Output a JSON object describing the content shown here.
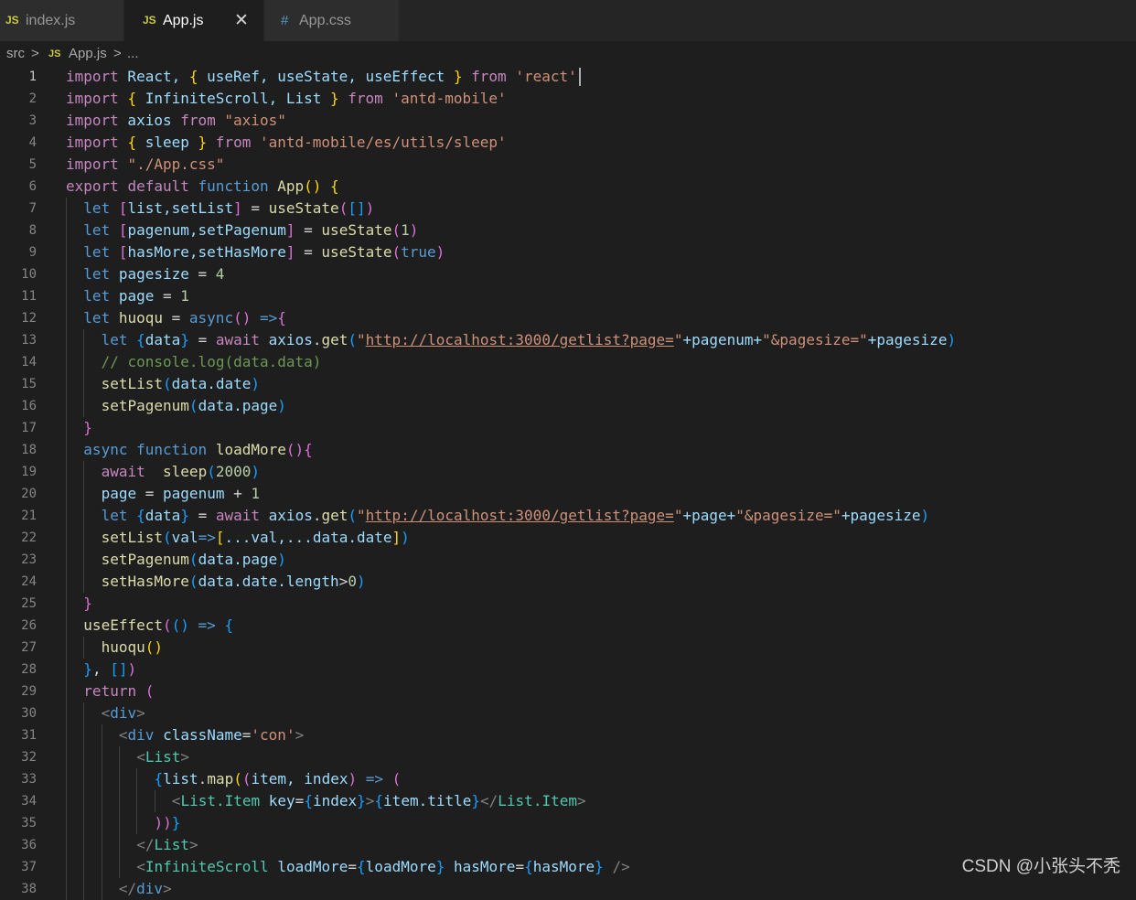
{
  "tabs": [
    {
      "icon": "JS",
      "label": "index.js"
    },
    {
      "icon": "JS",
      "label": "App.js",
      "close": "✕"
    },
    {
      "icon": "#",
      "label": "App.css"
    }
  ],
  "breadcrumb": {
    "folder": "src",
    "sep1": ">",
    "file_icon": "JS",
    "file": "App.js",
    "sep2": ">",
    "more": "..."
  },
  "editor": {
    "active_line": 1,
    "cursor_line": 1,
    "lines": [
      {
        "n": "1",
        "indent": 0,
        "tokens": [
          [
            "import",
            "ctl"
          ],
          [
            " React, ",
            "var"
          ],
          [
            "{",
            "b1"
          ],
          [
            " useRef, useState, useEffect ",
            "var"
          ],
          [
            "}",
            "b1"
          ],
          [
            " ",
            "plain"
          ],
          [
            "from",
            "ctl"
          ],
          [
            " ",
            "plain"
          ],
          [
            "'react'",
            "str"
          ]
        ]
      },
      {
        "n": "2",
        "indent": 0,
        "tokens": [
          [
            "import",
            "ctl"
          ],
          [
            " ",
            "plain"
          ],
          [
            "{",
            "b1"
          ],
          [
            " InfiniteScroll, List ",
            "var"
          ],
          [
            "}",
            "b1"
          ],
          [
            " ",
            "plain"
          ],
          [
            "from",
            "ctl"
          ],
          [
            " ",
            "plain"
          ],
          [
            "'antd-mobile'",
            "str"
          ]
        ]
      },
      {
        "n": "3",
        "indent": 0,
        "tokens": [
          [
            "import",
            "ctl"
          ],
          [
            " axios ",
            "var"
          ],
          [
            "from",
            "ctl"
          ],
          [
            " ",
            "plain"
          ],
          [
            "\"axios\"",
            "str"
          ]
        ]
      },
      {
        "n": "4",
        "indent": 0,
        "tokens": [
          [
            "import",
            "ctl"
          ],
          [
            " ",
            "plain"
          ],
          [
            "{",
            "b1"
          ],
          [
            " sleep ",
            "var"
          ],
          [
            "}",
            "b1"
          ],
          [
            " ",
            "plain"
          ],
          [
            "from",
            "ctl"
          ],
          [
            " ",
            "plain"
          ],
          [
            "'antd-mobile/es/utils/sleep'",
            "str"
          ]
        ]
      },
      {
        "n": "5",
        "indent": 0,
        "tokens": [
          [
            "import",
            "ctl"
          ],
          [
            " ",
            "plain"
          ],
          [
            "\"./App.css\"",
            "str"
          ]
        ]
      },
      {
        "n": "6",
        "indent": 0,
        "tokens": [
          [
            "export",
            "ctl"
          ],
          [
            " ",
            "plain"
          ],
          [
            "default",
            "ctl"
          ],
          [
            " ",
            "plain"
          ],
          [
            "function",
            "kw"
          ],
          [
            " ",
            "plain"
          ],
          [
            "App",
            "fn"
          ],
          [
            "()",
            "b1"
          ],
          [
            " ",
            "plain"
          ],
          [
            "{",
            "b1"
          ]
        ]
      },
      {
        "n": "7",
        "indent": 1,
        "tokens": [
          [
            "let",
            "kw"
          ],
          [
            " ",
            "plain"
          ],
          [
            "[",
            "b2"
          ],
          [
            "list,setList",
            "var"
          ],
          [
            "]",
            "b2"
          ],
          [
            " = ",
            "plain"
          ],
          [
            "useState",
            "fn"
          ],
          [
            "(",
            "b2"
          ],
          [
            "[]",
            "b3"
          ],
          [
            ")",
            "b2"
          ]
        ]
      },
      {
        "n": "8",
        "indent": 1,
        "tokens": [
          [
            "let",
            "kw"
          ],
          [
            " ",
            "plain"
          ],
          [
            "[",
            "b2"
          ],
          [
            "pagenum,setPagenum",
            "var"
          ],
          [
            "]",
            "b2"
          ],
          [
            " = ",
            "plain"
          ],
          [
            "useState",
            "fn"
          ],
          [
            "(",
            "b2"
          ],
          [
            "1",
            "num"
          ],
          [
            ")",
            "b2"
          ]
        ]
      },
      {
        "n": "9",
        "indent": 1,
        "tokens": [
          [
            "let",
            "kw"
          ],
          [
            " ",
            "plain"
          ],
          [
            "[",
            "b2"
          ],
          [
            "hasMore,setHasMore",
            "var"
          ],
          [
            "]",
            "b2"
          ],
          [
            " = ",
            "plain"
          ],
          [
            "useState",
            "fn"
          ],
          [
            "(",
            "b2"
          ],
          [
            "true",
            "kw"
          ],
          [
            ")",
            "b2"
          ]
        ]
      },
      {
        "n": "10",
        "indent": 1,
        "tokens": [
          [
            "let",
            "kw"
          ],
          [
            " pagesize ",
            "var"
          ],
          [
            "= ",
            "plain"
          ],
          [
            "4",
            "num"
          ]
        ]
      },
      {
        "n": "11",
        "indent": 1,
        "tokens": [
          [
            "let",
            "kw"
          ],
          [
            " page ",
            "var"
          ],
          [
            "= ",
            "plain"
          ],
          [
            "1",
            "num"
          ]
        ]
      },
      {
        "n": "12",
        "indent": 1,
        "tokens": [
          [
            "let",
            "kw"
          ],
          [
            " huoqu ",
            "fn"
          ],
          [
            "= ",
            "plain"
          ],
          [
            "async",
            "kw"
          ],
          [
            "()",
            "b2"
          ],
          [
            " ",
            "plain"
          ],
          [
            "=>",
            "kw"
          ],
          [
            "{",
            "b2"
          ]
        ]
      },
      {
        "n": "13",
        "indent": 2,
        "tokens": [
          [
            "let",
            "kw"
          ],
          [
            " ",
            "plain"
          ],
          [
            "{",
            "b3"
          ],
          [
            "data",
            "var"
          ],
          [
            "}",
            "b3"
          ],
          [
            " = ",
            "plain"
          ],
          [
            "await",
            "ctl"
          ],
          [
            " axios",
            "var"
          ],
          [
            ".",
            "plain"
          ],
          [
            "get",
            "fn"
          ],
          [
            "(",
            "b3"
          ],
          [
            "\"",
            "str"
          ],
          [
            "http://localhost:3000/getlist?page=",
            "str url"
          ],
          [
            "\"",
            "str"
          ],
          [
            "+pagenum+",
            "var"
          ],
          [
            "\"&pagesize=\"",
            "str"
          ],
          [
            "+pagesize",
            "var"
          ],
          [
            ")",
            "b3"
          ]
        ]
      },
      {
        "n": "14",
        "indent": 2,
        "tokens": [
          [
            "// console.log(data.data)",
            "cmt"
          ]
        ]
      },
      {
        "n": "15",
        "indent": 2,
        "tokens": [
          [
            "setList",
            "fn"
          ],
          [
            "(",
            "b3"
          ],
          [
            "data.date",
            "var"
          ],
          [
            ")",
            "b3"
          ]
        ]
      },
      {
        "n": "16",
        "indent": 2,
        "tokens": [
          [
            "setPagenum",
            "fn"
          ],
          [
            "(",
            "b3"
          ],
          [
            "data.page",
            "var"
          ],
          [
            ")",
            "b3"
          ]
        ]
      },
      {
        "n": "17",
        "indent": 1,
        "tokens": [
          [
            "}",
            "b2"
          ]
        ]
      },
      {
        "n": "18",
        "indent": 1,
        "tokens": [
          [
            "async",
            "kw"
          ],
          [
            " ",
            "plain"
          ],
          [
            "function",
            "kw"
          ],
          [
            " ",
            "plain"
          ],
          [
            "loadMore",
            "fn"
          ],
          [
            "()",
            "b2"
          ],
          [
            "{",
            "b2"
          ]
        ]
      },
      {
        "n": "19",
        "indent": 2,
        "tokens": [
          [
            "await",
            "ctl"
          ],
          [
            "  ",
            "plain"
          ],
          [
            "sleep",
            "fn"
          ],
          [
            "(",
            "b3"
          ],
          [
            "2000",
            "num"
          ],
          [
            ")",
            "b3"
          ]
        ]
      },
      {
        "n": "20",
        "indent": 2,
        "tokens": [
          [
            "page ",
            "var"
          ],
          [
            "= ",
            "plain"
          ],
          [
            "pagenum ",
            "var"
          ],
          [
            "+ ",
            "plain"
          ],
          [
            "1",
            "num"
          ]
        ]
      },
      {
        "n": "21",
        "indent": 2,
        "tokens": [
          [
            "let",
            "kw"
          ],
          [
            " ",
            "plain"
          ],
          [
            "{",
            "b3"
          ],
          [
            "data",
            "var"
          ],
          [
            "}",
            "b3"
          ],
          [
            " = ",
            "plain"
          ],
          [
            "await",
            "ctl"
          ],
          [
            " axios",
            "var"
          ],
          [
            ".",
            "plain"
          ],
          [
            "get",
            "fn"
          ],
          [
            "(",
            "b3"
          ],
          [
            "\"",
            "str"
          ],
          [
            "http://localhost:3000/getlist?page=",
            "str url"
          ],
          [
            "\"",
            "str"
          ],
          [
            "+page+",
            "var"
          ],
          [
            "\"&pagesize=\"",
            "str"
          ],
          [
            "+pagesize",
            "var"
          ],
          [
            ")",
            "b3"
          ]
        ]
      },
      {
        "n": "22",
        "indent": 2,
        "tokens": [
          [
            "setList",
            "fn"
          ],
          [
            "(",
            "b3"
          ],
          [
            "val",
            "var"
          ],
          [
            "=>",
            "kw"
          ],
          [
            "[",
            "b1"
          ],
          [
            "...val,...data.date",
            "var"
          ],
          [
            "]",
            "b1"
          ],
          [
            ")",
            "b3"
          ]
        ]
      },
      {
        "n": "23",
        "indent": 2,
        "tokens": [
          [
            "setPagenum",
            "fn"
          ],
          [
            "(",
            "b3"
          ],
          [
            "data.page",
            "var"
          ],
          [
            ")",
            "b3"
          ]
        ]
      },
      {
        "n": "24",
        "indent": 2,
        "tokens": [
          [
            "setHasMore",
            "fn"
          ],
          [
            "(",
            "b3"
          ],
          [
            "data.date.length",
            "var"
          ],
          [
            ">",
            "plain"
          ],
          [
            "0",
            "num"
          ],
          [
            ")",
            "b3"
          ]
        ]
      },
      {
        "n": "25",
        "indent": 1,
        "tokens": [
          [
            "}",
            "b2"
          ]
        ]
      },
      {
        "n": "26",
        "indent": 1,
        "tokens": [
          [
            "useEffect",
            "fn"
          ],
          [
            "(",
            "b2"
          ],
          [
            "()",
            "b3"
          ],
          [
            " ",
            "plain"
          ],
          [
            "=>",
            "kw"
          ],
          [
            " ",
            "plain"
          ],
          [
            "{",
            "b3"
          ]
        ]
      },
      {
        "n": "27",
        "indent": 2,
        "tokens": [
          [
            "huoqu",
            "fn"
          ],
          [
            "()",
            "b1"
          ]
        ]
      },
      {
        "n": "28",
        "indent": 1,
        "tokens": [
          [
            "}",
            "b3"
          ],
          [
            ", ",
            "plain"
          ],
          [
            "[]",
            "b3"
          ],
          [
            ")",
            "b2"
          ]
        ]
      },
      {
        "n": "29",
        "indent": 1,
        "tokens": [
          [
            "return",
            "ctl"
          ],
          [
            " ",
            "plain"
          ],
          [
            "(",
            "b2"
          ]
        ]
      },
      {
        "n": "30",
        "indent": 2,
        "tokens": [
          [
            "<",
            "punc"
          ],
          [
            "div",
            "tag"
          ],
          [
            ">",
            "punc"
          ]
        ]
      },
      {
        "n": "31",
        "indent": 3,
        "tokens": [
          [
            "<",
            "punc"
          ],
          [
            "div",
            "tag"
          ],
          [
            " className",
            "var"
          ],
          [
            "=",
            "plain"
          ],
          [
            "'con'",
            "str"
          ],
          [
            ">",
            "punc"
          ]
        ]
      },
      {
        "n": "32",
        "indent": 4,
        "tokens": [
          [
            "<",
            "punc"
          ],
          [
            "List",
            "cls"
          ],
          [
            ">",
            "punc"
          ]
        ]
      },
      {
        "n": "33",
        "indent": 5,
        "tokens": [
          [
            "{",
            "b3"
          ],
          [
            "list",
            "var"
          ],
          [
            ".",
            "plain"
          ],
          [
            "map",
            "fn"
          ],
          [
            "(",
            "b1"
          ],
          [
            "(",
            "b2"
          ],
          [
            "item, index",
            "var"
          ],
          [
            ")",
            "b2"
          ],
          [
            " ",
            "plain"
          ],
          [
            "=>",
            "kw"
          ],
          [
            " ",
            "plain"
          ],
          [
            "(",
            "b2"
          ]
        ]
      },
      {
        "n": "34",
        "indent": 6,
        "tokens": [
          [
            "<",
            "punc"
          ],
          [
            "List.Item",
            "cls"
          ],
          [
            " key",
            "var"
          ],
          [
            "=",
            "plain"
          ],
          [
            "{",
            "b3"
          ],
          [
            "index",
            "var"
          ],
          [
            "}",
            "b3"
          ],
          [
            ">",
            "punc"
          ],
          [
            "{",
            "b3"
          ],
          [
            "item.title",
            "var"
          ],
          [
            "}",
            "b3"
          ],
          [
            "</",
            "punc"
          ],
          [
            "List.Item",
            "cls"
          ],
          [
            ">",
            "punc"
          ]
        ]
      },
      {
        "n": "35",
        "indent": 5,
        "tokens": [
          [
            "))",
            "b2"
          ],
          [
            "}",
            "b3"
          ]
        ]
      },
      {
        "n": "36",
        "indent": 4,
        "tokens": [
          [
            "</",
            "punc"
          ],
          [
            "List",
            "cls"
          ],
          [
            ">",
            "punc"
          ]
        ]
      },
      {
        "n": "37",
        "indent": 4,
        "tokens": [
          [
            "<",
            "punc"
          ],
          [
            "InfiniteScroll",
            "cls"
          ],
          [
            " loadMore",
            "var"
          ],
          [
            "=",
            "plain"
          ],
          [
            "{",
            "b3"
          ],
          [
            "loadMore",
            "var"
          ],
          [
            "}",
            "b3"
          ],
          [
            " hasMore",
            "var"
          ],
          [
            "=",
            "plain"
          ],
          [
            "{",
            "b3"
          ],
          [
            "hasMore",
            "var"
          ],
          [
            "}",
            "b3"
          ],
          [
            " ",
            "plain"
          ],
          [
            "/>",
            "punc"
          ]
        ]
      },
      {
        "n": "38",
        "indent": 3,
        "tokens": [
          [
            "</",
            "punc"
          ],
          [
            "div",
            "tag"
          ],
          [
            ">",
            "punc"
          ]
        ]
      }
    ]
  },
  "watermark": "CSDN @小张头不秃"
}
